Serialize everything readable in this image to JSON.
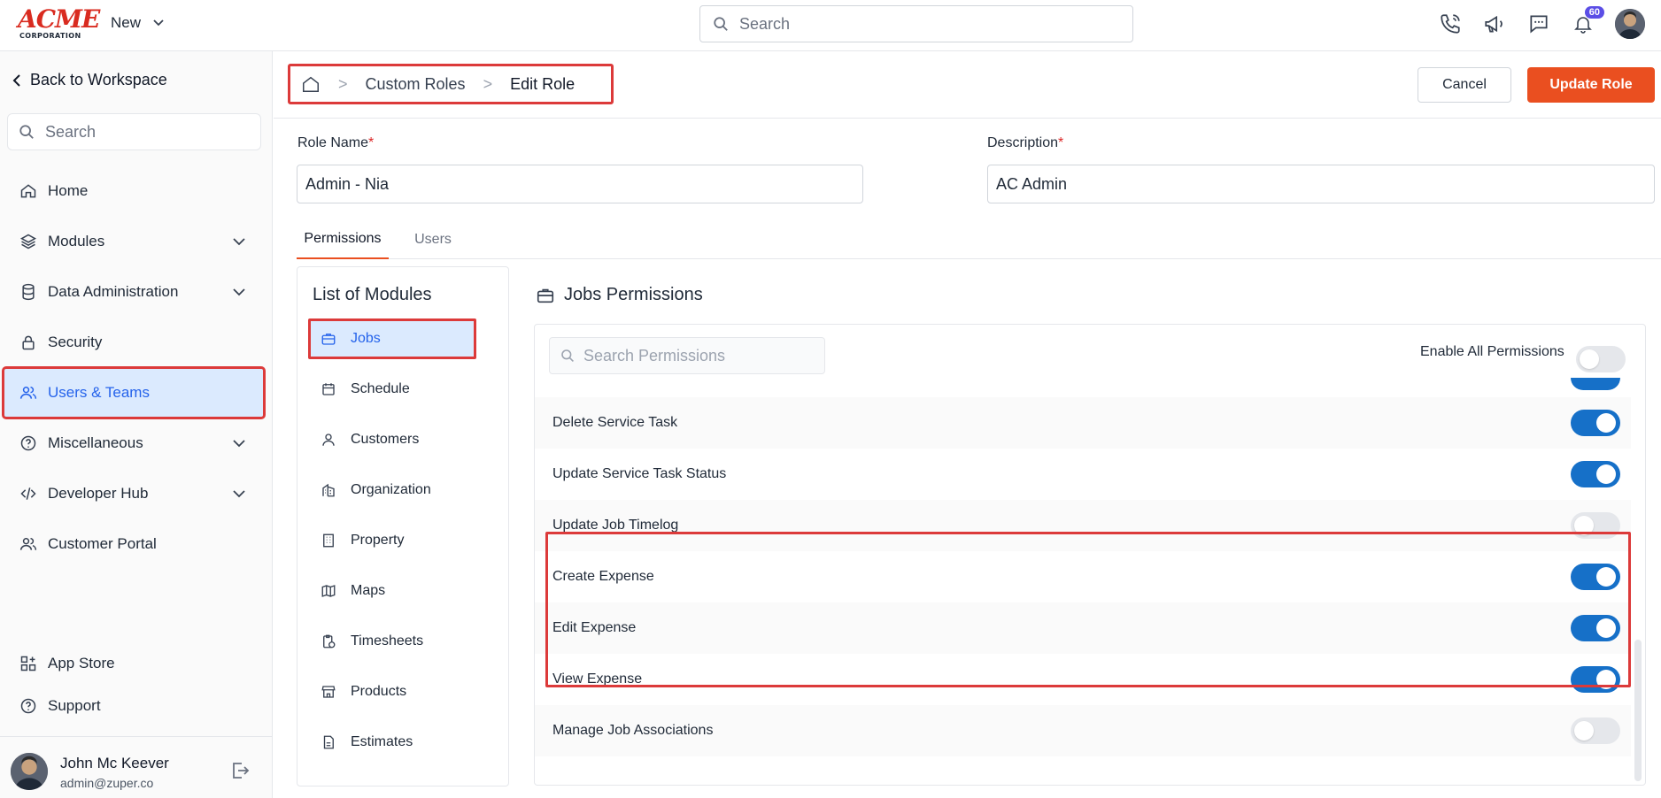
{
  "brand": {
    "logo_top": "ACME",
    "logo_bottom": "CORPORATION",
    "accent": "#ea4f20",
    "primary": "#1670c8"
  },
  "topbar": {
    "new_label": "New",
    "search_placeholder": "Search",
    "notification_count": "60",
    "icons": [
      "phone-icon",
      "megaphone-icon",
      "chat-icon",
      "bell-icon"
    ]
  },
  "sidebar": {
    "back_label": "Back to Workspace",
    "search_placeholder": "Search",
    "items": [
      {
        "label": "Home",
        "icon": "home-icon"
      },
      {
        "label": "Modules",
        "icon": "layers-icon"
      },
      {
        "label": "Data Administration",
        "icon": "database-icon"
      },
      {
        "label": "Security",
        "icon": "lock-icon"
      },
      {
        "label": "Users & Teams",
        "icon": "users-icon"
      },
      {
        "label": "Miscellaneous",
        "icon": "help-icon"
      },
      {
        "label": "Developer Hub",
        "icon": "code-icon"
      },
      {
        "label": "Customer Portal",
        "icon": "users-icon"
      },
      {
        "label": "App Store",
        "icon": "apps-icon"
      },
      {
        "label": "Support",
        "icon": "help-icon"
      }
    ],
    "user": {
      "name": "John Mc Keever",
      "email": "admin@zuper.co"
    }
  },
  "breadcrumb": {
    "items": [
      "Custom Roles",
      "Edit Role"
    ]
  },
  "actions": {
    "cancel": "Cancel",
    "update": "Update Role"
  },
  "form": {
    "role_name_label": "Role Name",
    "role_name_value": "Admin - Nia",
    "description_label": "Description",
    "description_value": "AC Admin",
    "required_mark": "*"
  },
  "tabs": [
    "Permissions",
    "Users"
  ],
  "modules": {
    "title": "List of Modules",
    "items": [
      {
        "label": "Jobs",
        "icon": "briefcase-icon"
      },
      {
        "label": "Schedule",
        "icon": "calendar-icon"
      },
      {
        "label": "Customers",
        "icon": "person-icon"
      },
      {
        "label": "Organization",
        "icon": "building-icon"
      },
      {
        "label": "Property",
        "icon": "property-icon"
      },
      {
        "label": "Maps",
        "icon": "map-icon"
      },
      {
        "label": "Timesheets",
        "icon": "clipboard-icon"
      },
      {
        "label": "Products",
        "icon": "store-icon"
      },
      {
        "label": "Estimates",
        "icon": "document-icon"
      }
    ]
  },
  "permissions": {
    "title": "Jobs Permissions",
    "search_placeholder": "Search Permissions",
    "enable_all_label": "Enable All Permissions",
    "enable_all": false,
    "rows": [
      {
        "label": "Delete Service Task",
        "enabled": true
      },
      {
        "label": "Update Service Task Status",
        "enabled": true
      },
      {
        "label": "Update Job Timelog",
        "enabled": false
      },
      {
        "label": "Create Expense",
        "enabled": true
      },
      {
        "label": "Edit Expense",
        "enabled": true
      },
      {
        "label": "View Expense",
        "enabled": true
      },
      {
        "label": "Manage Job Associations",
        "enabled": false
      }
    ]
  }
}
